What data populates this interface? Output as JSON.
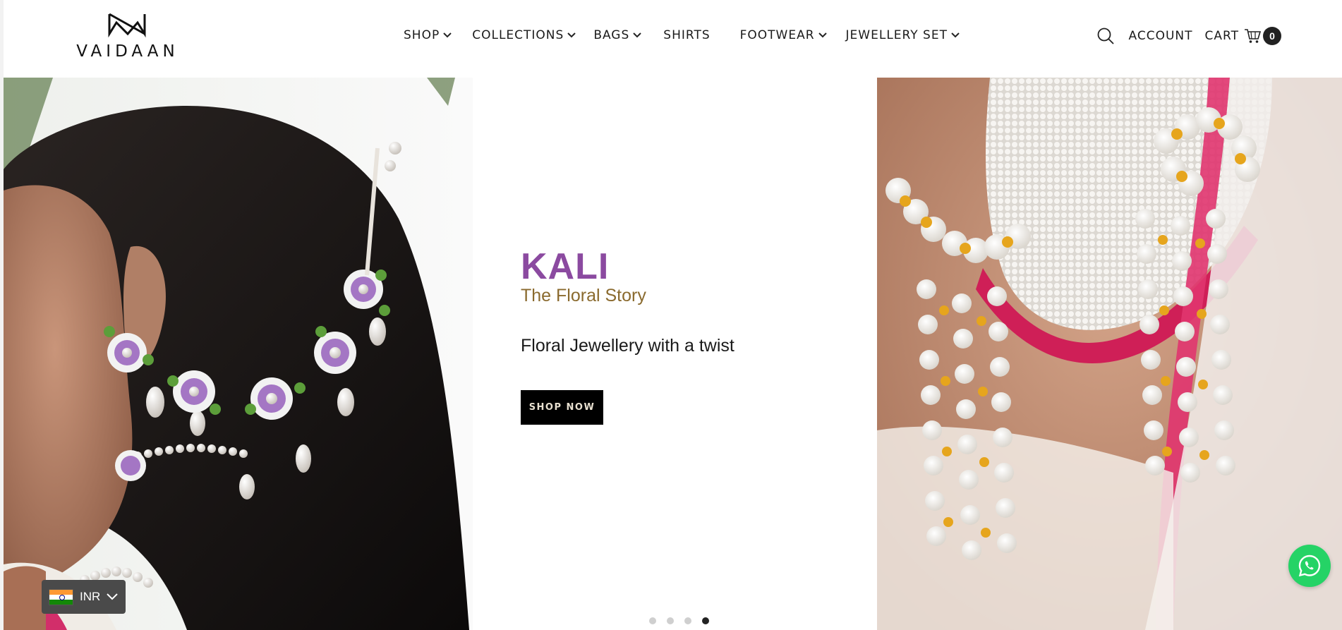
{
  "brand": {
    "name": "VAIDAAN"
  },
  "nav": {
    "items": [
      {
        "label": "SHOP",
        "has_dropdown": true
      },
      {
        "label": "COLLECTIONS",
        "has_dropdown": true
      },
      {
        "label": "BAGS",
        "has_dropdown": true
      },
      {
        "label": "SHIRTS",
        "has_dropdown": false
      },
      {
        "label": "FOOTWEAR",
        "has_dropdown": true
      },
      {
        "label": "JEWELLERY SET",
        "has_dropdown": true
      }
    ]
  },
  "header_utils": {
    "search_icon": "search-icon",
    "account_label": "ACCOUNT",
    "cart_label": "CART",
    "cart_count": "0"
  },
  "hero": {
    "title": "KALI",
    "subtitle": "The Floral Story",
    "tagline": "Floral Jewellery with a twist",
    "cta_label": "SHOP NOW",
    "slide_count": 4,
    "active_slide": 4
  },
  "currency": {
    "code": "INR",
    "flag": "india-flag-icon"
  },
  "colors": {
    "title": "#8b4aa0",
    "subtitle": "#8a6a2e",
    "cta_bg": "#000000",
    "whatsapp": "#25d366",
    "currency_bg": "#4a4a4a"
  }
}
